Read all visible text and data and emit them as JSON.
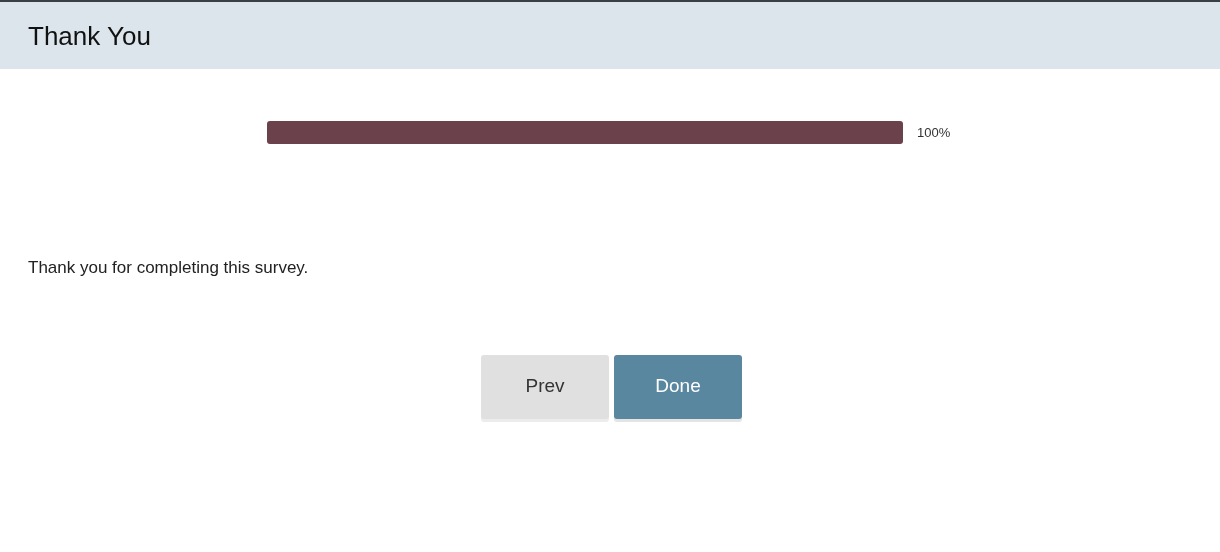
{
  "header": {
    "title": "Thank You"
  },
  "progress": {
    "level": 1,
    "reading": "100%"
  },
  "message": "Thank you for completing this survey.",
  "buttons": [
    {
      "label": "Prev",
      "kind": "secondary"
    },
    {
      "label": "Done",
      "kind": "primary"
    }
  ]
}
